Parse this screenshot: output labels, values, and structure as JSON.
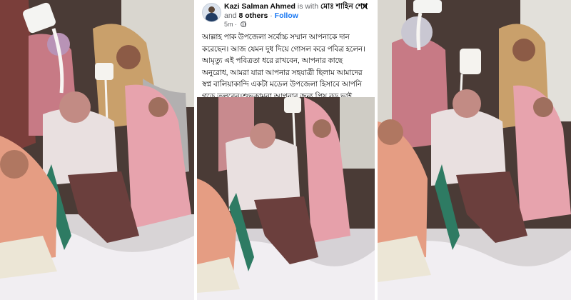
{
  "post": {
    "author": "Kazi Salman Ahmed",
    "is_with_text": "is with",
    "tagged_person": "মোঃ শাহিন শেখ",
    "and_text": "and",
    "others": "8 others",
    "separator": "·",
    "follow_label": "Follow",
    "timestamp": "5m",
    "meta_separator": "·",
    "privacy_icon": "globe-icon",
    "close_icon": "close-icon",
    "close_label": "✕",
    "body": "আল্লাহ পাক উপজেলা সর্বোচ্চ সম্মান আপনাকে দান করেছেন। আজ যেমন দুধ দিয়ে গোসল করে পবিত্র হলেন। আমৃত্যু এই পবিত্রতা ধরে রাখবেন, আপনার কাছে অনুরোধ, আমরা যারা আপনার সহযাত্রী ছিলাম আমাদের স্বপ্ন বালিয়াকান্দি একটা মডেল উপজেলা হিসাবে আপনি গড়ে তুলবেন।শুভকামনা আপনার জন্য প্রিয় বড় ভাই,"
  },
  "colors": {
    "follow_blue": "#1877f2",
    "text_primary": "#050505",
    "text_secondary": "#65676b"
  }
}
